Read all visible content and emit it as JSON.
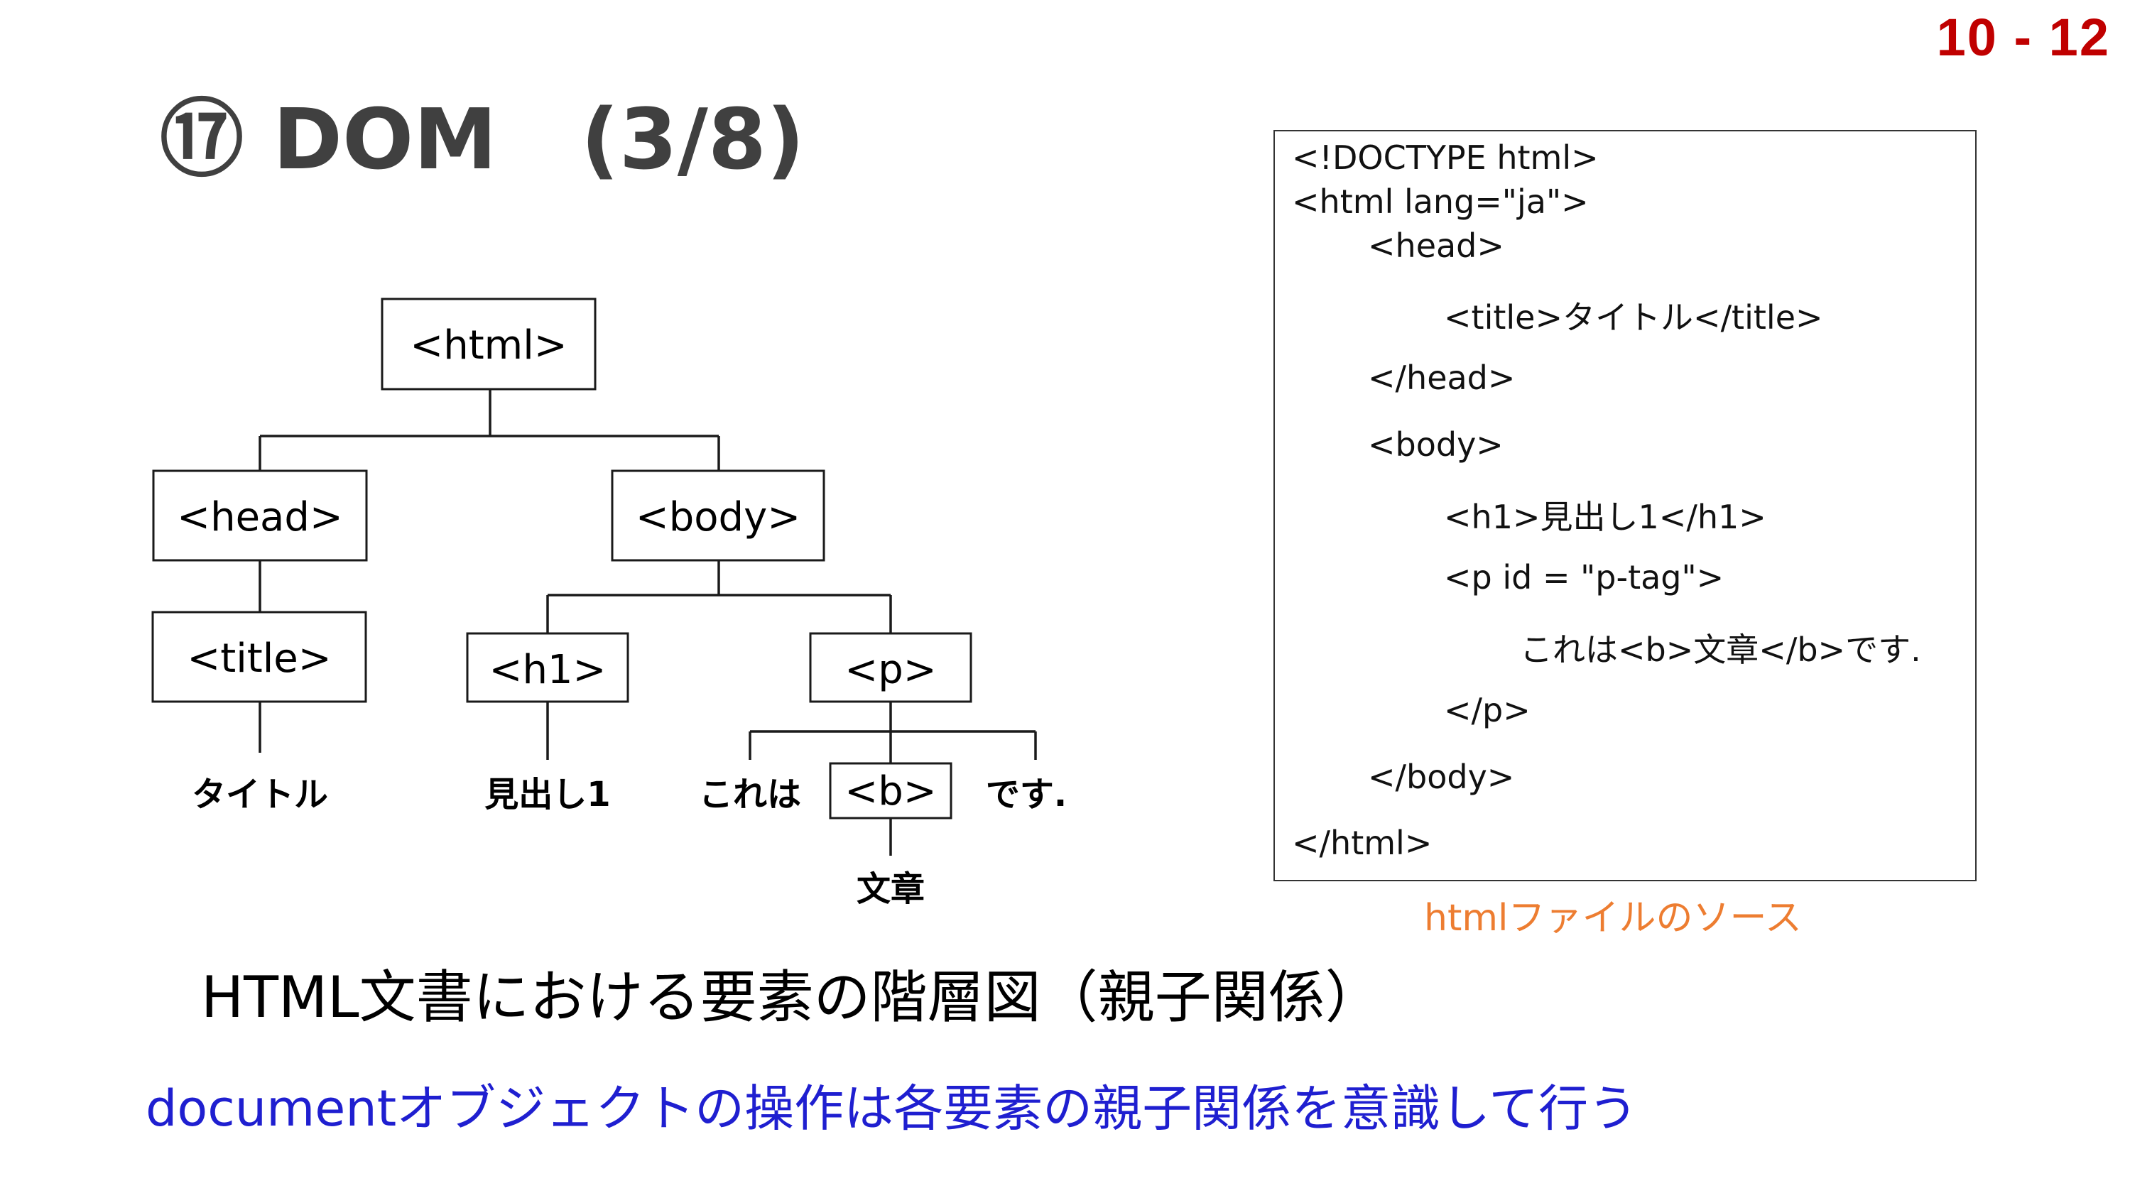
{
  "page_number": "10 - 12",
  "title": "⑰ DOM　(3/8)",
  "tree": {
    "nodes": {
      "html": "<html>",
      "head": "<head>",
      "body": "<body>",
      "title": "<title>",
      "h1": "<h1>",
      "p": "<p>",
      "b": "<b>"
    },
    "texts": {
      "title_text": "タイトル",
      "h1_text": "見出し1",
      "p_before": "これは",
      "p_after": "です.",
      "b_text": "文章"
    }
  },
  "source": {
    "lines": [
      "<!DOCTYPE html>",
      "<html lang=\"ja\">",
      "<head>",
      "<title>タイトル</title>",
      "</head>",
      "<body>",
      "<h1>見出し1</h1>",
      "<p id = \"p-tag\">",
      "これは<b>文章</b>です.",
      "</p>",
      "</body>",
      "</html>"
    ],
    "caption": "htmlファイルのソース"
  },
  "diagram_caption": "HTML文書における要素の階層図（親子関係）",
  "note": "documentオブジェクトの操作は各要素の親子関係を意識して行う",
  "colors": {
    "page_number": "#c00000",
    "title": "#404040",
    "source_caption": "#ed7d31",
    "note": "#1f1fd0"
  }
}
